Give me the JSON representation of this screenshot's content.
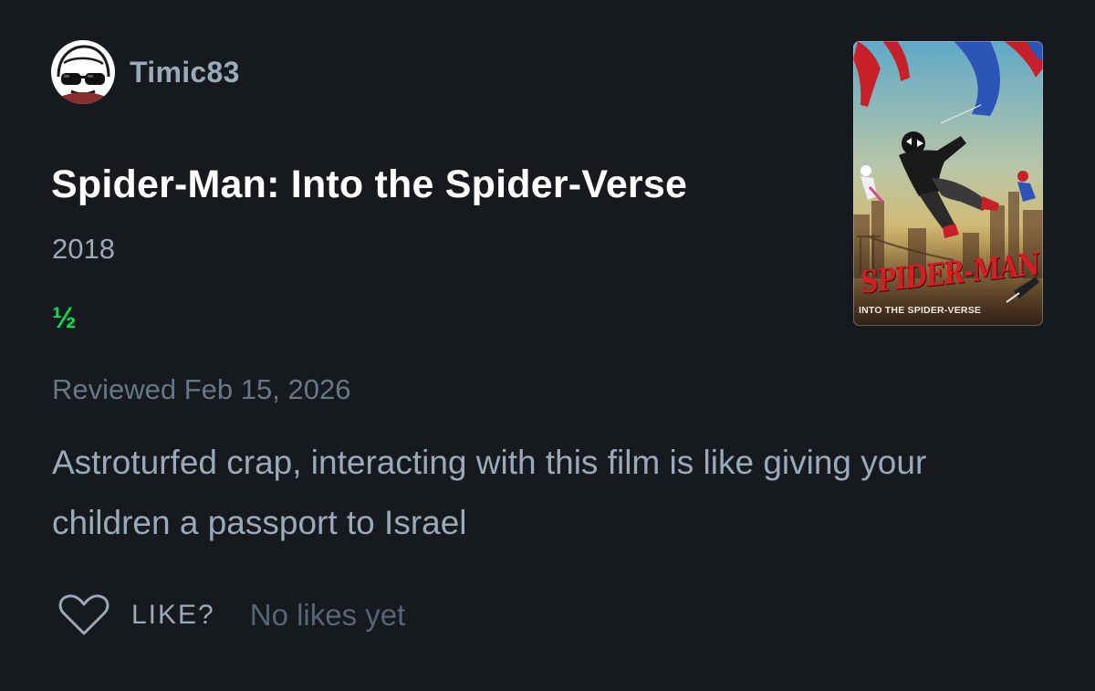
{
  "review": {
    "author": "Timic83",
    "film_title": "Spider-Man: Into the Spider-Verse",
    "film_year": "2018",
    "rating": "½",
    "reviewed_date": "Reviewed Feb 15, 2026",
    "body": "Astroturfed crap, interacting with this film is like giving your children a passport to Israel"
  },
  "poster": {
    "title_text": "SPIDER-MAN",
    "subtitle_text": "INTO THE SPIDER-VERSE"
  },
  "actions": {
    "like_label": "LIKE?",
    "like_count_text": "No likes yet"
  },
  "icons": {
    "avatar": "sunglasses-face-avatar",
    "like": "heart-outline-icon"
  },
  "colors": {
    "background": "#16191d",
    "primary_text": "#ffffff",
    "secondary_text": "#99aabb",
    "muted_text": "#667788",
    "rating_green": "#00e054"
  }
}
